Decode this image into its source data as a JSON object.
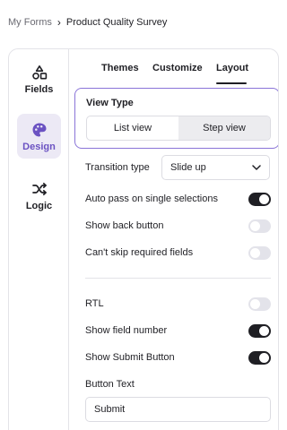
{
  "breadcrumb": {
    "root": "My Forms",
    "separator": "›",
    "current": "Product Quality Survey"
  },
  "sidebar": {
    "items": [
      {
        "label": "Fields",
        "icon": "shapes-icon",
        "active": false
      },
      {
        "label": "Design",
        "icon": "palette-icon",
        "active": true
      },
      {
        "label": "Logic",
        "icon": "shuffle-icon",
        "active": false
      }
    ]
  },
  "tabs": [
    {
      "label": "Themes",
      "active": false
    },
    {
      "label": "Customize",
      "active": false
    },
    {
      "label": "Layout",
      "active": true
    }
  ],
  "view_type": {
    "title": "View Type",
    "options": [
      "List view",
      "Step view"
    ],
    "selected": "Step view"
  },
  "transition": {
    "label": "Transition type",
    "value": "Slide up",
    "icon": "chevron-down-icon"
  },
  "settings": [
    {
      "label": "Auto pass on single selections",
      "on": true
    },
    {
      "label": "Show back button",
      "on": false
    },
    {
      "label": "Can't skip required fields",
      "on": false
    },
    {
      "label": "RTL",
      "on": false
    },
    {
      "label": "Show field number",
      "on": true
    },
    {
      "label": "Show Submit Button",
      "on": true
    }
  ],
  "button_text": {
    "label": "Button Text",
    "value": "Submit"
  },
  "colors": {
    "accent": "#6b52c2",
    "accent_bg": "#ece9f5",
    "toggle_on": "#1f1f24",
    "toggle_off": "#e3e3ea",
    "border": "#e3e3e8"
  }
}
